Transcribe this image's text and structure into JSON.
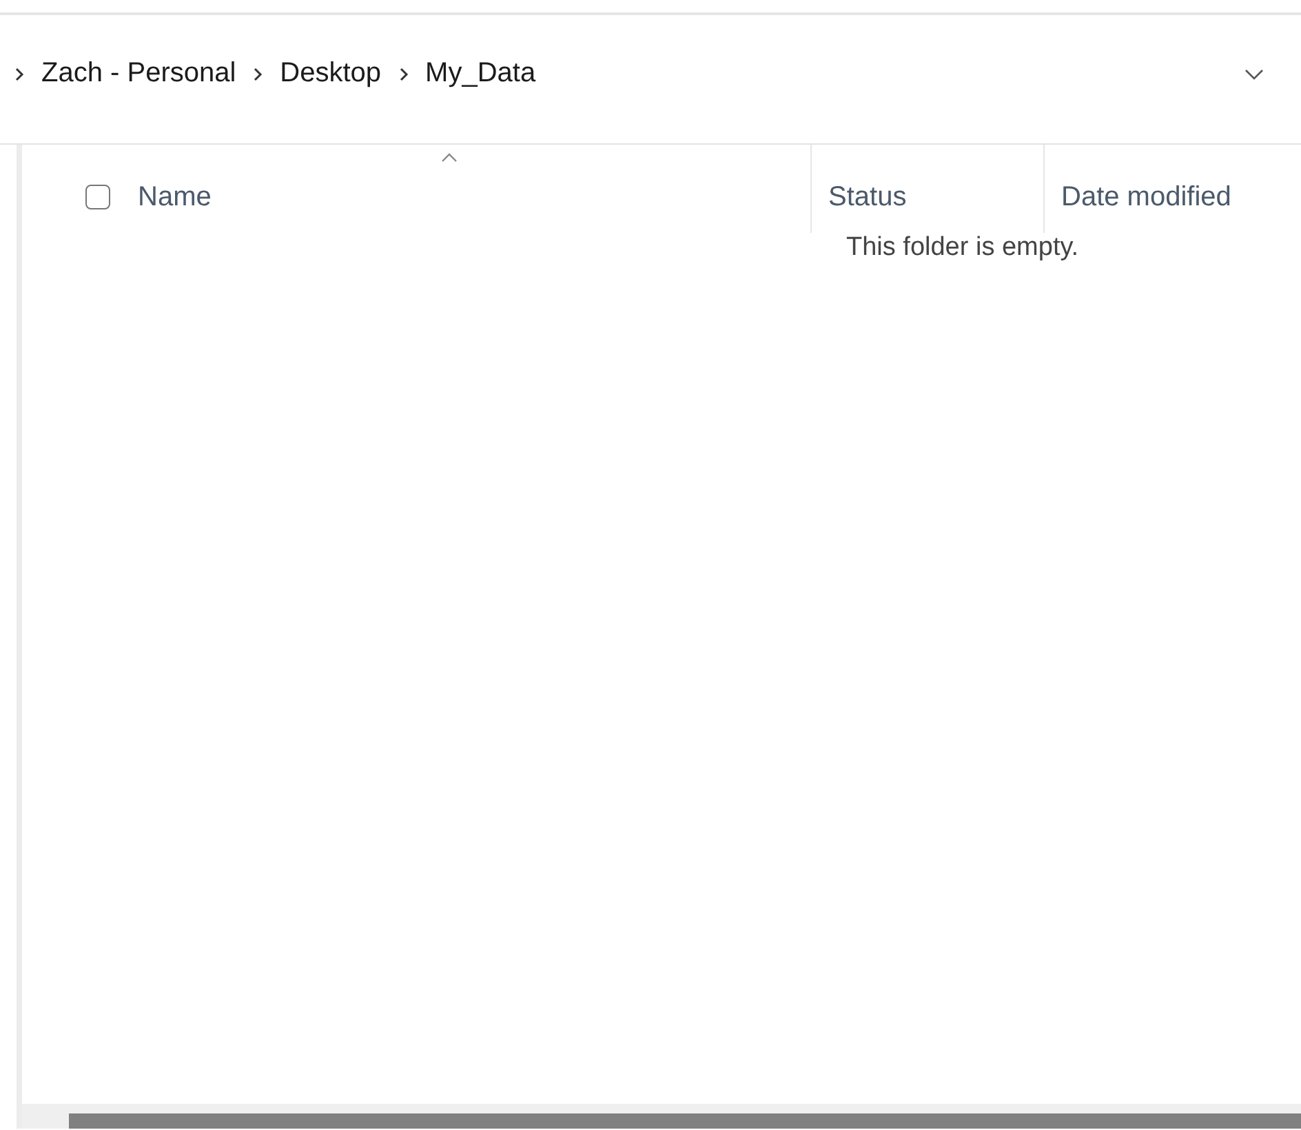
{
  "breadcrumb": [
    {
      "label": "Zach - Personal"
    },
    {
      "label": "Desktop"
    },
    {
      "label": "My_Data"
    }
  ],
  "columns": [
    {
      "label": "Name",
      "sorted": true
    },
    {
      "label": "Status",
      "sorted": false
    },
    {
      "label": "Date modified",
      "sorted": false
    }
  ],
  "select_all": {
    "checked": false
  },
  "empty_message": "This folder is empty."
}
